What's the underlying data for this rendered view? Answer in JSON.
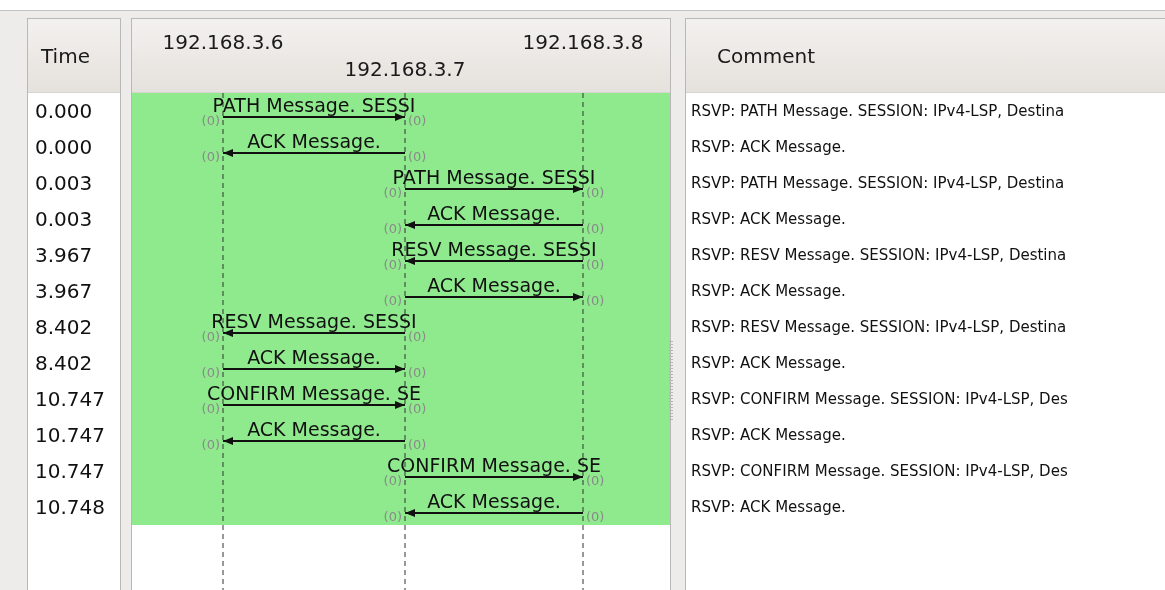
{
  "columns": {
    "time": "Time",
    "comment": "Comment"
  },
  "nodes": [
    {
      "address": "192.168.3.6"
    },
    {
      "address": "192.168.3.7"
    },
    {
      "address": "192.168.3.8"
    }
  ],
  "flows": [
    {
      "time": "0.000",
      "right_lane": false,
      "rightward": true,
      "label": "PATH Message. SESSI",
      "from_port": "(0)",
      "to_port": "(0)",
      "comment": "RSVP: PATH Message. SESSION: IPv4-LSP, Destina"
    },
    {
      "time": "0.000",
      "right_lane": false,
      "rightward": false,
      "label": "ACK Message.",
      "from_port": "(0)",
      "to_port": "(0)",
      "comment": "RSVP: ACK Message."
    },
    {
      "time": "0.003",
      "right_lane": true,
      "rightward": true,
      "label": "PATH Message. SESSI",
      "from_port": "(0)",
      "to_port": "(0)",
      "comment": "RSVP: PATH Message. SESSION: IPv4-LSP, Destina"
    },
    {
      "time": "0.003",
      "right_lane": true,
      "rightward": false,
      "label": "ACK Message.",
      "from_port": "(0)",
      "to_port": "(0)",
      "comment": "RSVP: ACK Message."
    },
    {
      "time": "3.967",
      "right_lane": true,
      "rightward": false,
      "label": "RESV Message. SESSI",
      "from_port": "(0)",
      "to_port": "(0)",
      "comment": "RSVP: RESV Message. SESSION: IPv4-LSP, Destina"
    },
    {
      "time": "3.967",
      "right_lane": true,
      "rightward": true,
      "label": "ACK Message.",
      "from_port": "(0)",
      "to_port": "(0)",
      "comment": "RSVP: ACK Message."
    },
    {
      "time": "8.402",
      "right_lane": false,
      "rightward": false,
      "label": "RESV Message. SESSI",
      "from_port": "(0)",
      "to_port": "(0)",
      "comment": "RSVP: RESV Message. SESSION: IPv4-LSP, Destina"
    },
    {
      "time": "8.402",
      "right_lane": false,
      "rightward": true,
      "label": "ACK Message.",
      "from_port": "(0)",
      "to_port": "(0)",
      "comment": "RSVP: ACK Message."
    },
    {
      "time": "10.747",
      "right_lane": false,
      "rightward": true,
      "label": "CONFIRM Message. SE",
      "from_port": "(0)",
      "to_port": "(0)",
      "comment": "RSVP: CONFIRM Message. SESSION: IPv4-LSP, Des"
    },
    {
      "time": "10.747",
      "right_lane": false,
      "rightward": false,
      "label": "ACK Message.",
      "from_port": "(0)",
      "to_port": "(0)",
      "comment": "RSVP: ACK Message."
    },
    {
      "time": "10.747",
      "right_lane": true,
      "rightward": true,
      "label": "CONFIRM Message. SE",
      "from_port": "(0)",
      "to_port": "(0)",
      "comment": "RSVP: CONFIRM Message. SESSION: IPv4-LSP, Des"
    },
    {
      "time": "10.748",
      "right_lane": true,
      "rightward": false,
      "label": "ACK Message.",
      "from_port": "(0)",
      "to_port": "(0)",
      "comment": "RSVP: ACK Message."
    }
  ]
}
